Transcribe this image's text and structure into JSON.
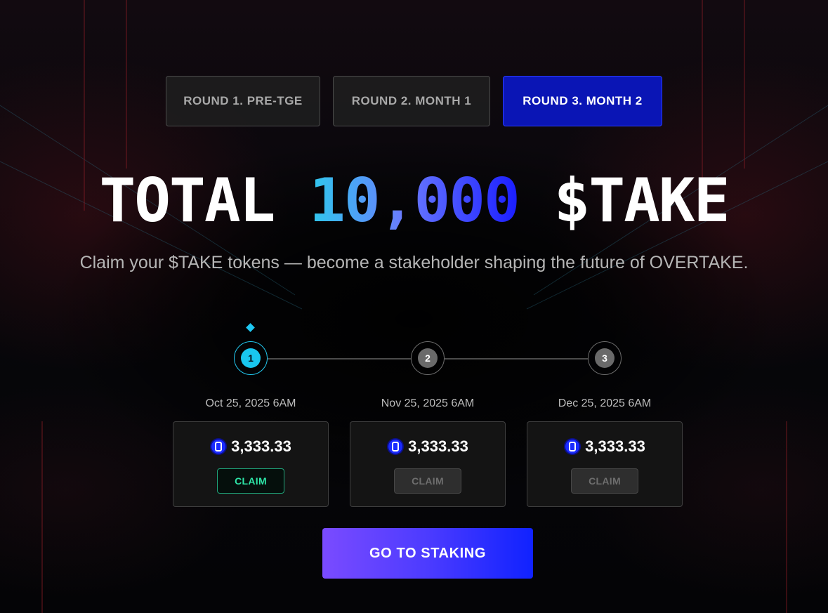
{
  "rounds": [
    {
      "label": "ROUND 1. PRE-TGE",
      "active": false
    },
    {
      "label": "ROUND 2. MONTH 1",
      "active": false
    },
    {
      "label": "ROUND 3. MONTH 2",
      "active": true
    }
  ],
  "hero": {
    "prefix": "TOTAL ",
    "amount": "10,000",
    "suffix": " $TAKE",
    "subtitle": "Claim your $TAKE tokens — become a stakeholder shaping the future of OVERTAKE."
  },
  "steps": [
    {
      "number": "1",
      "date": "Oct 25, 2025 6AM",
      "amount": "3,333.33",
      "claim_label": "CLAIM",
      "claim_enabled": true,
      "active": true
    },
    {
      "number": "2",
      "date": "Nov 25, 2025 6AM",
      "amount": "3,333.33",
      "claim_label": "CLAIM",
      "claim_enabled": false,
      "active": false
    },
    {
      "number": "3",
      "date": "Dec 25, 2025 6AM",
      "amount": "3,333.33",
      "claim_label": "CLAIM",
      "claim_enabled": false,
      "active": false
    }
  ],
  "cta": {
    "label": "GO TO STAKING"
  },
  "colors": {
    "active_tab": "#0a15b5",
    "step_active": "#19c6ef",
    "claim_enabled": "#2ee6a8",
    "cta_start": "#7a4bff",
    "cta_end": "#1022ff"
  },
  "icons": {
    "token": "overtake-coin-icon",
    "step_marker": "diamond-icon"
  }
}
